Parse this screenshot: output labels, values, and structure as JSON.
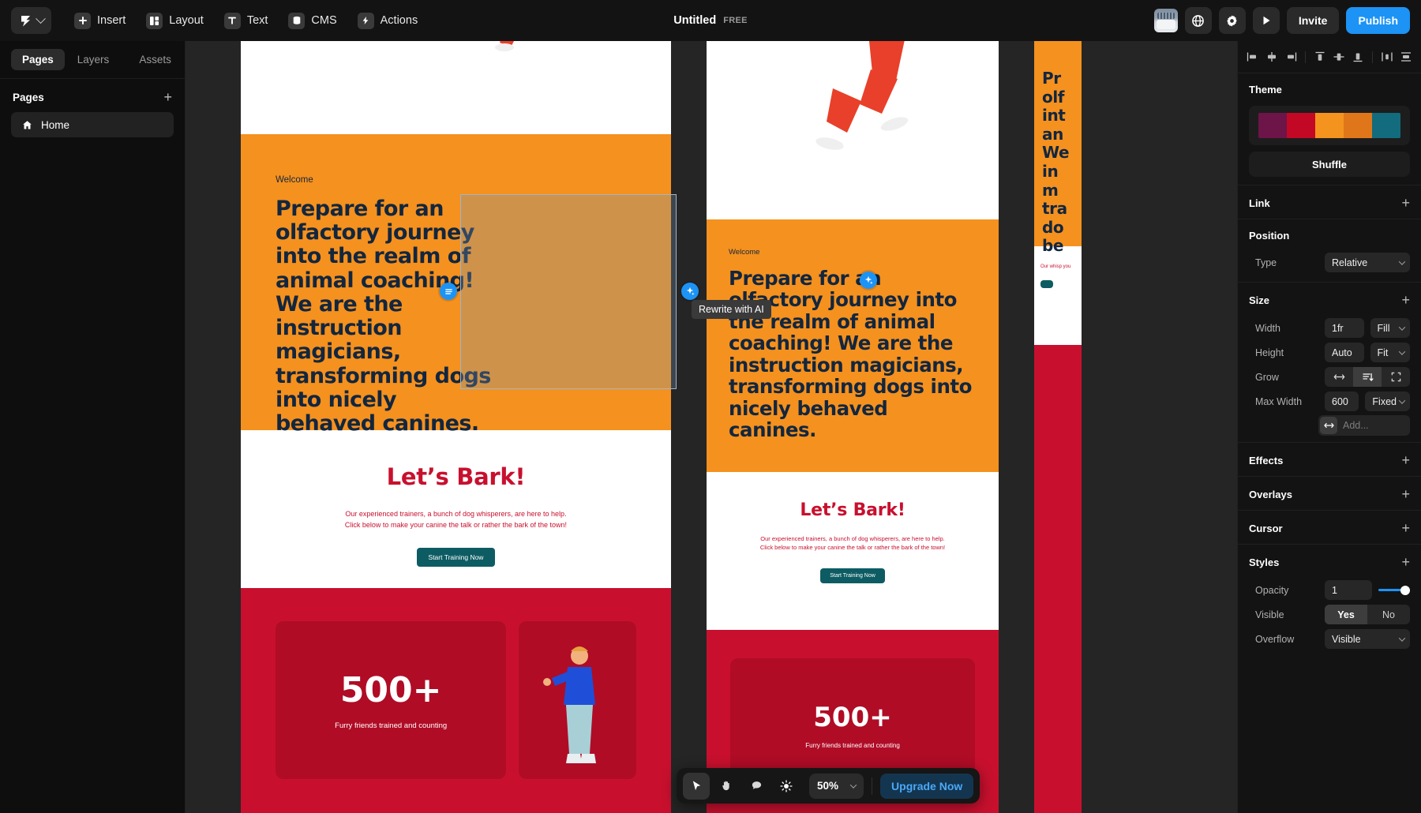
{
  "topbar": {
    "logo_icon": "app-logo-icon",
    "menu": [
      {
        "label": "Insert",
        "icon": "plus-square-icon"
      },
      {
        "label": "Layout",
        "icon": "layout-grid-icon"
      },
      {
        "label": "Text",
        "icon": "text-t-icon"
      },
      {
        "label": "CMS",
        "icon": "database-icon"
      },
      {
        "label": "Actions",
        "icon": "lightning-bolt-icon"
      }
    ],
    "doc_title": "Untitled",
    "plan_badge": "FREE",
    "globe_icon": "globe-icon",
    "settings_icon": "gear-icon",
    "preview_icon": "play-icon",
    "invite_label": "Invite",
    "publish_label": "Publish",
    "publish_color": "#1c93f5"
  },
  "left_panel": {
    "tabs": [
      {
        "label": "Pages",
        "active": true
      },
      {
        "label": "Layers",
        "active": false
      },
      {
        "label": "Assets",
        "active": false
      }
    ],
    "section_title": "Pages",
    "add_icon": "plus-icon",
    "pages": [
      {
        "label": "Home",
        "icon": "home-icon"
      }
    ]
  },
  "canvas": {
    "selection_tooltip": "Rewrite with AI",
    "ai_icon": "sparkle-ai-icon",
    "menu_icon": "hamburger-handle-icon",
    "desktop_frame": {
      "kicker": "Welcome",
      "heading": "Prepare for an olfactory journey into the realm of animal coaching! We are the instruction magicians, transforming dogs into nicely behaved canines.",
      "bark_heading": "Let’s Bark!",
      "bark_paragraph": "Our experienced trainers, a bunch of dog whisperers, are here to help. Click below to make your canine the talk or rather the bark of the town!",
      "cta_label": "Start Training Now",
      "stat_number": "500+",
      "stat_label": "Furry friends trained and counting"
    },
    "tablet_frame": {
      "kicker": "Welcome",
      "heading": "Prepare for an olfactory journey into the realm of animal coaching! We are the instruction magicians, transforming dogs into nicely behaved canines.",
      "bark_heading": "Let’s Bark!",
      "bark_paragraph": "Our experienced trainers, a bunch of dog whisperers, are here to help. Click below to make your canine the talk or rather the bark of the town!",
      "cta_label": "Start Training Now",
      "stat_number": "500+",
      "stat_label": "Furry friends trained and counting"
    },
    "mobile_frame": {
      "heading_fragment": "Pr olf int an We in m tra do be",
      "body_fragment": "Our whisp you"
    }
  },
  "bottom_toolbar": {
    "tools": [
      {
        "name": "select-tool",
        "icon": "cursor-arrow-icon",
        "active": true
      },
      {
        "name": "pan-tool",
        "icon": "hand-icon",
        "active": false
      },
      {
        "name": "comment-tool",
        "icon": "comment-bubble-icon",
        "active": false
      },
      {
        "name": "theme-tool",
        "icon": "sun-brightness-icon",
        "active": false
      }
    ],
    "zoom_value": "50%",
    "zoom_chevron": "chevron-down-icon",
    "upgrade_label": "Upgrade Now",
    "upgrade_color": "#4aa8f7"
  },
  "right_panel": {
    "align_buttons": [
      "align-left-icon",
      "align-center-horizontal-icon",
      "align-right-icon",
      "align-top-icon",
      "align-middle-vertical-icon",
      "align-bottom-icon",
      "distribute-horizontal-icon",
      "distribute-vertical-icon"
    ],
    "theme": {
      "title": "Theme",
      "colors": [
        "#6d1449",
        "#c20824",
        "#f5931f",
        "#e0761a",
        "#136b7e"
      ],
      "shuffle_label": "Shuffle"
    },
    "link": {
      "title": "Link",
      "add_icon": "plus-icon"
    },
    "position": {
      "title": "Position",
      "type_label": "Type",
      "type_value": "Relative"
    },
    "size": {
      "title": "Size",
      "add_icon": "arrows-horizontal-icon",
      "width_label": "Width",
      "width_value": "1fr",
      "width_mode": "Fill",
      "height_label": "Height",
      "height_value": "Auto",
      "height_mode": "Fit",
      "grow_label": "Grow",
      "grow_options": [
        "grow-horizontal-icon",
        "grow-vertical-icon",
        "grow-both-icon"
      ],
      "grow_active_index": 1,
      "maxwidth_label": "Max Width",
      "maxwidth_value": "600",
      "maxwidth_mode": "Fixed",
      "add_placeholder": "Add..."
    },
    "effects": {
      "title": "Effects",
      "add_icon": "plus-icon"
    },
    "overlays": {
      "title": "Overlays",
      "add_icon": "plus-icon"
    },
    "cursor": {
      "title": "Cursor",
      "add_icon": "plus-icon"
    },
    "styles": {
      "title": "Styles",
      "add_icon": "plus-icon",
      "opacity_label": "Opacity",
      "opacity_value": "1",
      "visible_label": "Visible",
      "visible_yes": "Yes",
      "visible_no": "No",
      "visible_selected": "Yes",
      "overflow_label": "Overflow",
      "overflow_value": "Visible"
    }
  }
}
